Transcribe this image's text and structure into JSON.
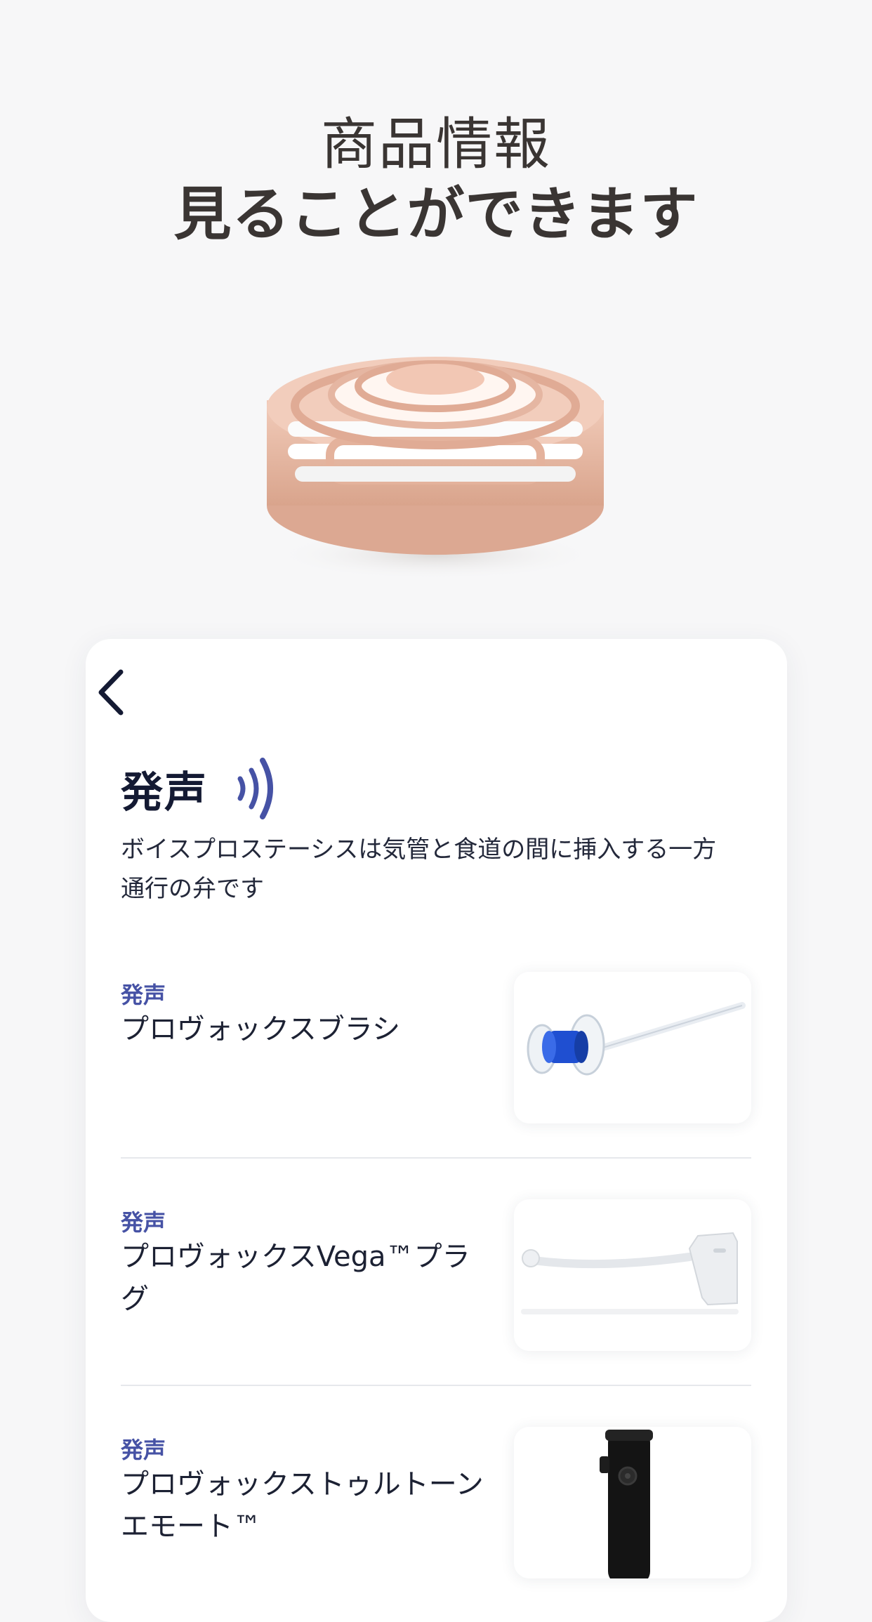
{
  "hero": {
    "line1": "商品情報",
    "line2": "見ることができます"
  },
  "section": {
    "title": "発声",
    "description": "ボイスプロステーシスは気管と食道の間に挿入する一方通行の弁です"
  },
  "products": [
    {
      "category": "発声",
      "name": "プロヴォックスブラシ"
    },
    {
      "category": "発声",
      "name": "プロヴォックスVega™プラグ"
    },
    {
      "category": "発声",
      "name": "プロヴォックストゥルトーンエモート™"
    }
  ],
  "colors": {
    "background": "#f7f7f8",
    "card": "#ffffff",
    "accent": "#4652a5",
    "heading": "#141a33",
    "hero_text": "#3a3533",
    "peach": "#e8b8a3"
  },
  "icons": {
    "back": "chevron-left-icon",
    "voice": "sound-waves-icon"
  }
}
